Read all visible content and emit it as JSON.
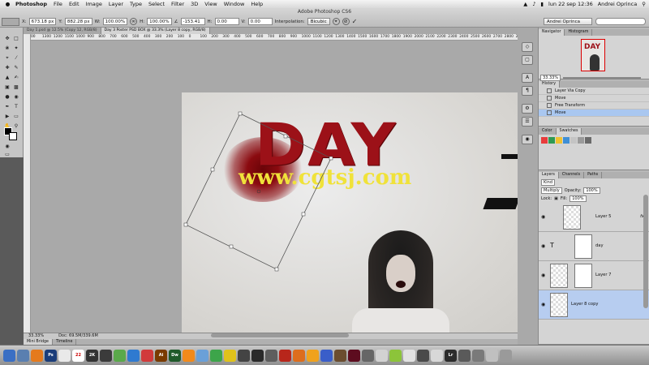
{
  "menubar": {
    "app": "Photoshop",
    "items": [
      "File",
      "Edit",
      "Image",
      "Layer",
      "Type",
      "Select",
      "Filter",
      "3D",
      "View",
      "Window",
      "Help"
    ],
    "datetime": "lun 22 sep  12:36",
    "user": "Andrei Oprinca"
  },
  "window_title": "Adobe Photoshop CS6",
  "options": {
    "x_label": "X:",
    "x_value": "673.18 px",
    "y_label": "Y:",
    "y_value": "882.28 px",
    "w_label": "W:",
    "w_value": "100.00%",
    "h_label": "H:",
    "h_value": "100.00%",
    "angle_value": "-153.41",
    "hskew_label": "H:",
    "hskew_value": "0.00",
    "vskew_label": "V:",
    "vskew_value": "0.00",
    "interp_label": "Interpolation:",
    "interp_value": "Bicubic",
    "workspace": "Andrei Oprinca"
  },
  "tabs": [
    {
      "label": "Day 1.psd @ 12.5% (Copy 12, RGB/8)",
      "active": false
    },
    {
      "label": "Day 3 Poster PSD BOX @ 33.3% (Layer 8 copy, RGB/8)",
      "active": true
    }
  ],
  "ruler_ticks": [
    "00",
    "1300",
    "1200",
    "1100",
    "1000",
    "900",
    "800",
    "700",
    "600",
    "500",
    "400",
    "300",
    "200",
    "100",
    "0",
    "100",
    "200",
    "300",
    "400",
    "500",
    "600",
    "700",
    "800",
    "900",
    "1000",
    "1100",
    "1200",
    "1300",
    "1400",
    "1500",
    "1600",
    "1700",
    "1800",
    "1900",
    "2000",
    "2100",
    "2200",
    "2300",
    "2400",
    "2500",
    "2600",
    "2700",
    "2800",
    "2900",
    "3000"
  ],
  "canvas": {
    "poster_text": "DAY",
    "watermark": "www.cgtsj.com"
  },
  "status": {
    "zoom": "33.33%",
    "doc": "Doc: 69.5M/339.6M"
  },
  "bottom_tabs": [
    "Mini Bridge",
    "Timeline"
  ],
  "navigator": {
    "tabs": [
      "Navigator",
      "Histogram"
    ],
    "thumb_text": "DAY",
    "zoom": "33.33%"
  },
  "history": {
    "tabs": [
      "History"
    ],
    "items": [
      {
        "label": "Layer Via Copy",
        "active": false
      },
      {
        "label": "Move",
        "active": false
      },
      {
        "label": "Free Transform",
        "active": false
      },
      {
        "label": "Move",
        "active": true
      }
    ]
  },
  "color_panel": {
    "tabs": [
      "Color",
      "Swatches"
    ],
    "swatches": [
      "#e83c3c",
      "#2f9a52",
      "#f0c230",
      "#3f8fd6",
      "#c4c4c4",
      "#9a9a9a",
      "#6a6a6a"
    ]
  },
  "layers": {
    "tabs": [
      "Layers",
      "Channels",
      "Paths"
    ],
    "filter": "Kind",
    "blend": "Multiply",
    "opacity_label": "Opacity:",
    "opacity": "100%",
    "lock_label": "Lock:",
    "fill_label": "Fill:",
    "fill": "100%",
    "rows": [
      {
        "name": "Layer 5",
        "fx": "fx",
        "active": false
      },
      {
        "name": "day",
        "fx": "",
        "active": false
      },
      {
        "name": "Layer 7",
        "fx": "",
        "active": false
      },
      {
        "name": "Layer 8 copy",
        "fx": "",
        "active": true
      }
    ]
  },
  "dock": [
    {
      "label": "",
      "color": "#3a6fc4"
    },
    {
      "label": "",
      "color": "#5a7fb0"
    },
    {
      "label": "",
      "color": "#e57a1d"
    },
    {
      "label": "Ps",
      "color": "#1b3d7a"
    },
    {
      "label": "",
      "color": "#e9e9e9"
    },
    {
      "label": "22",
      "color": "#ffffff"
    },
    {
      "label": "2K",
      "color": "#333333"
    },
    {
      "label": "",
      "color": "#3b3b3b"
    },
    {
      "label": "",
      "color": "#5aa94a"
    },
    {
      "label": "",
      "color": "#2f7ad0"
    },
    {
      "label": "",
      "color": "#d13b3b"
    },
    {
      "label": "Ai",
      "color": "#7a3b00"
    },
    {
      "label": "Dw",
      "color": "#1f5a2a"
    },
    {
      "label": "",
      "color": "#f28a1b"
    },
    {
      "label": "",
      "color": "#6aa0d8"
    },
    {
      "label": "",
      "color": "#3da54a"
    },
    {
      "label": "",
      "color": "#e0c21b"
    },
    {
      "label": "",
      "color": "#444444"
    },
    {
      "label": "",
      "color": "#2a2a2a"
    },
    {
      "label": "",
      "color": "#5e5e5e"
    },
    {
      "label": "",
      "color": "#b8261b"
    },
    {
      "label": "",
      "color": "#dd6d1d"
    },
    {
      "label": "",
      "color": "#f0a21d"
    },
    {
      "label": "",
      "color": "#3a5ec9"
    },
    {
      "label": "",
      "color": "#6b4d2f"
    },
    {
      "label": "",
      "color": "#5d0c1f"
    },
    {
      "label": "",
      "color": "#666666"
    },
    {
      "label": "",
      "color": "#d2d2d2"
    },
    {
      "label": "",
      "color": "#8cc43a"
    },
    {
      "label": "",
      "color": "#e2e2e2"
    },
    {
      "label": "",
      "color": "#4a4a4a"
    },
    {
      "label": "",
      "color": "#d8d8d8"
    },
    {
      "label": "Lr",
      "color": "#2c2c2c"
    },
    {
      "label": "",
      "color": "#5a5a5a"
    },
    {
      "label": "",
      "color": "#7a7a7a"
    },
    {
      "label": "",
      "color": "#c0c0c0"
    },
    {
      "label": "",
      "color": "#9a9a9a"
    }
  ]
}
